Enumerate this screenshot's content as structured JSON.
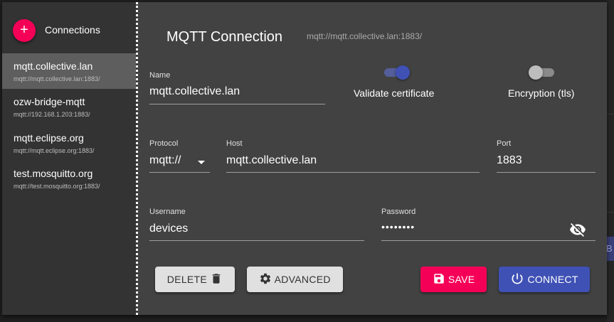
{
  "sidebar": {
    "title": "Connections",
    "add_icon": "+",
    "items": [
      {
        "name": "mqtt.collective.lan",
        "url": "mqtt://mqtt.collective.lan:1883/"
      },
      {
        "name": "ozw-bridge-mqtt",
        "url": "mqtt://192.168.1.203:1883/"
      },
      {
        "name": "mqtt.eclipse.org",
        "url": "mqtt://mqtt.eclipse.org:1883/"
      },
      {
        "name": "test.mosquitto.org",
        "url": "mqtt://test.mosquitto.org:1883/"
      }
    ],
    "active_index": 0
  },
  "main": {
    "title": "MQTT Connection",
    "url": "mqtt://mqtt.collective.lan:1883/"
  },
  "form": {
    "name_label": "Name",
    "name_value": "mqtt.collective.lan",
    "validate_label": "Validate certificate",
    "validate_on": true,
    "encryption_label": "Encryption (tls)",
    "encryption_on": false,
    "protocol_label": "Protocol",
    "protocol_value": "mqtt://",
    "host_label": "Host",
    "host_value": "mqtt.collective.lan",
    "port_label": "Port",
    "port_value": "1883",
    "username_label": "Username",
    "username_value": "devices",
    "password_label": "Password",
    "password_value": "••••••••"
  },
  "buttons": {
    "delete": "DELETE",
    "advanced": "ADVANCED",
    "save": "SAVE",
    "connect": "CONNECT"
  },
  "background": {
    "partial_button_text": "B"
  },
  "colors": {
    "accent_pink": "#f50057",
    "primary_indigo": "#3f51b5",
    "switch_on_thumb": "#3f51b5",
    "switch_off_thumb": "#bdbdbd",
    "dialog_bg": "#424242",
    "sidebar_bg": "#333333",
    "selected_item_bg": "#5e5e5e"
  },
  "icons": {
    "delete": "trash-icon",
    "advanced": "gear-icon",
    "save": "floppy-disk-icon",
    "connect": "power-icon",
    "password_visibility": "eye-off-icon",
    "protocol_dropdown": "caret-down-icon"
  }
}
